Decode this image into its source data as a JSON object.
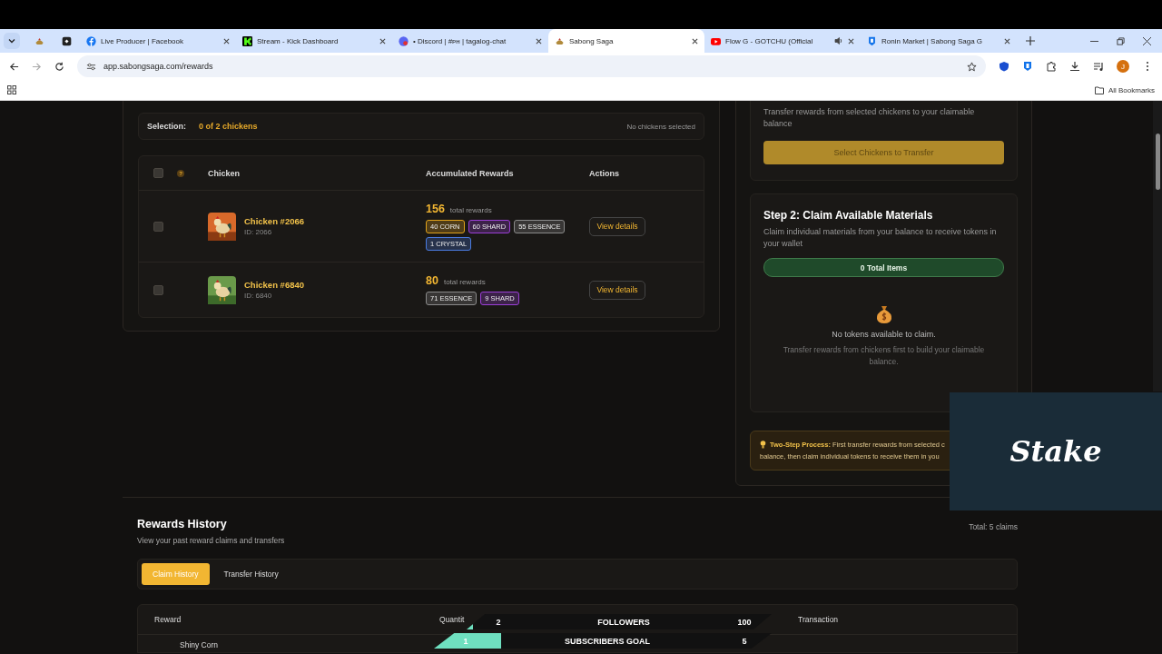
{
  "browser": {
    "tabs": [
      {
        "kind": "pinned",
        "selected": false
      },
      {
        "kind": "pinned",
        "selected": false
      },
      {
        "kind": "page",
        "title": "Live Producer | Facebook",
        "selected": false
      },
      {
        "kind": "page",
        "title": "Stream - Kick Dashboard",
        "selected": false
      },
      {
        "kind": "page",
        "title": "• Discord | #ᴘʜ | tagalog-chat",
        "selected": false
      },
      {
        "kind": "page",
        "title": "Sabong Saga",
        "selected": true
      },
      {
        "kind": "page",
        "title": "Flow G - GOTCHU (Official",
        "selected": false,
        "audio": true
      },
      {
        "kind": "page",
        "title": "Ronin Market | Sabong Saga G",
        "selected": false
      }
    ],
    "url": "app.sabongsaga.com/rewards",
    "avatar": "J",
    "bookmarks": "All Bookmarks"
  },
  "selection": {
    "label": "Selection:",
    "value": "0 of 2 chickens",
    "status": "No chickens selected"
  },
  "table": {
    "all_checked": false,
    "help": "?",
    "columns": [
      "Chicken",
      "Accumulated Rewards",
      "Actions"
    ],
    "rows": [
      {
        "checked": false,
        "name": "Chicken #2066",
        "id": "ID: 2066",
        "total": "156",
        "total_label": "total rewards",
        "action": "View details",
        "rewards": [
          {
            "text": "40 CORN",
            "color": "#e0a11b"
          },
          {
            "text": "60 SHARD",
            "color": "#9b3fd6"
          },
          {
            "text": "55 ESSENCE",
            "color": "#8a8a8a"
          },
          {
            "text": "1 CRYSTAL",
            "color": "#4a7be0"
          }
        ]
      },
      {
        "checked": false,
        "name": "Chicken #6840",
        "id": "ID: 6840",
        "total": "80",
        "total_label": "total rewards",
        "action": "View details",
        "rewards": [
          {
            "text": "71 ESSENCE",
            "color": "#8a8a8a"
          },
          {
            "text": "9 SHARD",
            "color": "#9b3fd6"
          }
        ]
      }
    ]
  },
  "transfer": {
    "description": "Transfer rewards from selected chickens to your claimable balance",
    "button": {
      "label": "Select Chickens to Transfer",
      "disabled": true
    }
  },
  "claim": {
    "title": "Step 2: Claim Available Materials",
    "description": "Claim individual materials from your balance to receive tokens in your wallet",
    "total": "0 Total Items",
    "empty_title": "No tokens available to claim.",
    "empty_text": "Transfer rewards from chickens first to build your claimable balance."
  },
  "info": {
    "lines": [
      "**Two-Step Process:** First transfer rewards from selected c",
      "balance, then claim individual tokens to receive them in you"
    ]
  },
  "history": {
    "title": "Rewards History",
    "subtitle": "View your past reward claims and transfers",
    "total": "Total: 5 claims",
    "tabs": [
      {
        "label": "Claim History",
        "selected": true
      },
      {
        "label": "Transfer History",
        "selected": false
      }
    ],
    "columns": [
      "Reward",
      "Quantit",
      "Transaction"
    ],
    "rows": [
      {
        "reward": "Shiny Corn"
      }
    ]
  },
  "overlay": {
    "logo": "Stake",
    "goals": [
      {
        "count": "2",
        "label": "FOLLOWERS",
        "target": "100",
        "level": 0.02
      },
      {
        "count": "1",
        "label": "SUBSCRIBERS GOAL",
        "target": "5",
        "level": 0.2
      }
    ]
  }
}
